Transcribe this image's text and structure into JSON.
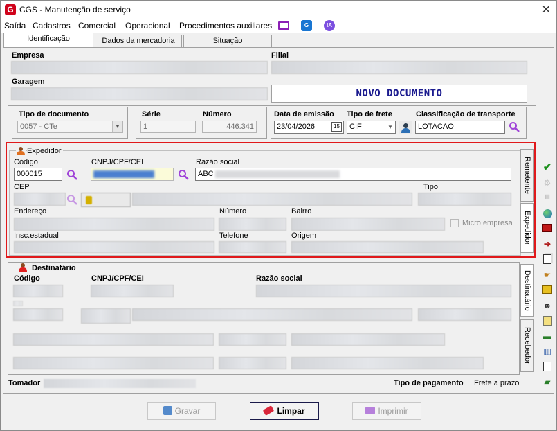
{
  "window": {
    "title": "CGS - Manutenção de serviço",
    "close": "✕"
  },
  "menu": {
    "items": [
      "Saída",
      "Cadastros",
      "Comercial",
      "Operacional",
      "Procedimentos auxiliares"
    ],
    "ia_label": "IA"
  },
  "tabs": [
    "Identificação",
    "Dados da mercadoria",
    "Situação"
  ],
  "ident": {
    "empresa_label": "Empresa",
    "filial_label": "Filial",
    "garagem_label": "Garagem",
    "banner": "NOVO DOCUMENTO",
    "tipo_doc_label": "Tipo de documento",
    "tipo_doc_value": "0057 - CTe",
    "serie_label": "Série",
    "serie_value": "1",
    "numero_label": "Número",
    "numero_value": "446.341",
    "data_emissao_label": "Data de emissão",
    "data_emissao_value": "23/04/2026",
    "tipo_frete_label": "Tipo de frete",
    "tipo_frete_value": "CIF",
    "classif_label": "Classificação de transporte",
    "classif_value": "LOTACAO"
  },
  "expedidor": {
    "title": "Expedidor",
    "codigo_label": "Código",
    "codigo_value": "000015",
    "cnpj_label": "CNPJ/CPF/CEI",
    "razao_label": "Razão social",
    "razao_value": "ABC",
    "cep_label": "CEP",
    "tipo_label": "Tipo",
    "endereco_label": "Endereço",
    "numero_label": "Número",
    "bairro_label": "Bairro",
    "micro_label": "Micro empresa",
    "insc_label": "Insc.estadual",
    "telefone_label": "Telefone",
    "origem_label": "Origem"
  },
  "side_tabs_top": [
    "Remetente",
    "Expedidor"
  ],
  "destinatario": {
    "title": "Destinatário",
    "codigo_label": "Código",
    "cnpj_label": "CNPJ/CPF/CEI",
    "razao_label": "Razão social"
  },
  "side_tabs_bottom": [
    "Destinatário",
    "Recebedor"
  ],
  "footer": {
    "tomador_label": "Tomador",
    "tipo_pagamento_label": "Tipo de pagamento",
    "tipo_pagamento_value": "Frete a prazo"
  },
  "buttons": {
    "gravar": "Gravar",
    "limpar": "Limpar",
    "imprimir": "Imprimir"
  },
  "colors": {
    "highlight": "#e0191b",
    "banner_text": "#1b1b8f",
    "magnifier": "#a044d8"
  }
}
